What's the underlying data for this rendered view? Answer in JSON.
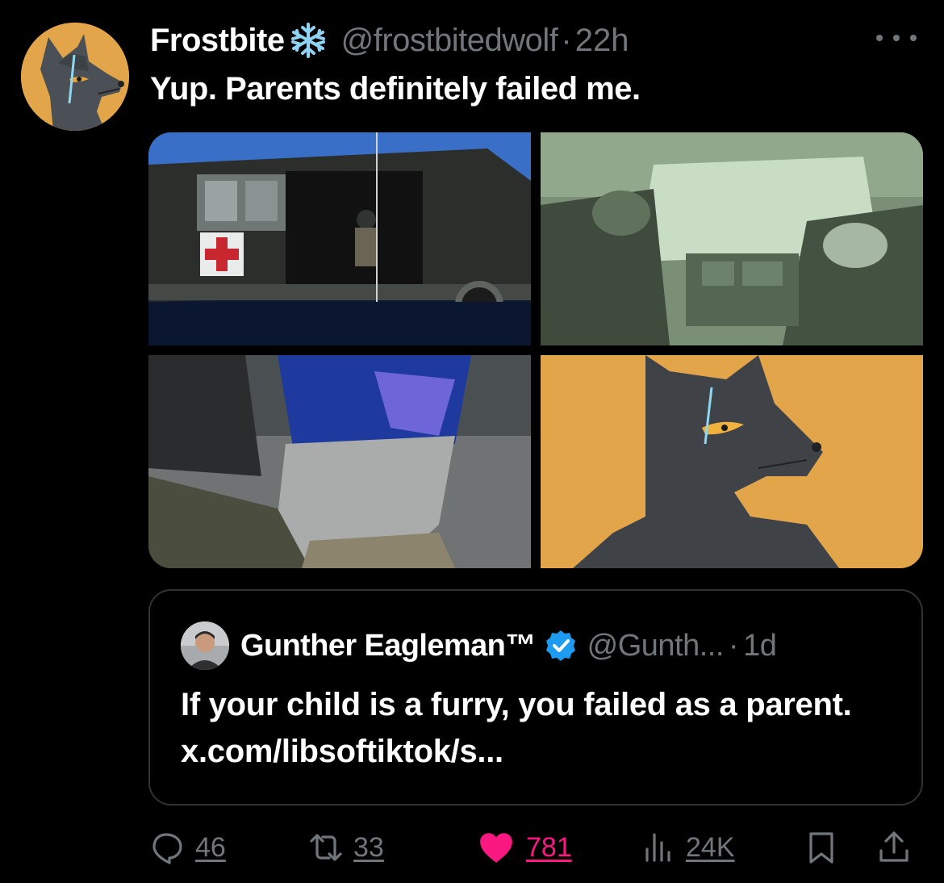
{
  "tweet": {
    "author": {
      "display_name": "Frostbite",
      "name_emoji_icon": "snowflake-icon",
      "handle": "@frostbitedwolf",
      "separator": "·",
      "time": "22h",
      "avatar_icon": "wolf-avatar"
    },
    "more_icon": "more-options-icon",
    "text": "Yup. Parents definitely failed me.",
    "media": [
      {
        "kind": "photo",
        "icon": "helicopter-photo"
      },
      {
        "kind": "photo",
        "icon": "night-vision-cockpit-photo"
      },
      {
        "kind": "photo",
        "icon": "pilot-visor-selfie-photo"
      },
      {
        "kind": "photo",
        "icon": "wolf-character-art"
      }
    ],
    "quoted": {
      "display_name": "Gunther Eagleman™",
      "verified_icon": "verified-badge-icon",
      "handle": "@Gunth...",
      "separator": "·",
      "time": "1d",
      "text": "If your child is a furry,  you failed as a parent. x.com/libsoftiktok/s..."
    },
    "actions": {
      "reply": {
        "icon": "reply-icon",
        "count": "46"
      },
      "repost": {
        "icon": "repost-icon",
        "count": "33"
      },
      "like": {
        "icon": "heart-icon",
        "count": "781",
        "liked": true
      },
      "views": {
        "icon": "views-icon",
        "count": "24K"
      },
      "bookmark": {
        "icon": "bookmark-icon"
      },
      "share": {
        "icon": "share-icon"
      }
    }
  },
  "colors": {
    "background": "#000000",
    "primary_text": "#ffffff",
    "secondary_text": "#71767b",
    "border": "#2f3336",
    "like": "#f91880",
    "verified": "#1d9bf0",
    "avatar_bg": "#e2a54a"
  }
}
